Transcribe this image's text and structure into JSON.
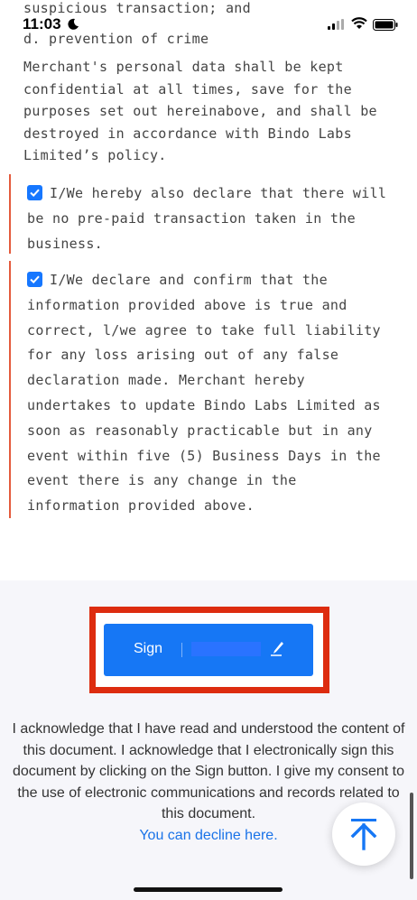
{
  "status_bar": {
    "time": "11:03",
    "overlap_text": "suspicious transaction; and"
  },
  "content": {
    "item_d": "d. prevention of crime",
    "confidentiality_paragraph": "Merchant's personal data shall be kept confidential at all times, save for the purposes set out hereinabove, and shall be destroyed in accordance with Bindo Labs Limited’s policy.",
    "declaration_1": {
      "checked": true,
      "text": "I/We hereby also declare that there will be no pre-paid transaction taken in the business."
    },
    "declaration_2": {
      "checked": true,
      "text": "I/We declare and confirm that the information provided above is true and correct, l/we agree to take full liability for any loss arising out of any false declaration made. Merchant hereby undertakes to update Bindo Labs Limited as soon as reasonably practicable but in any event within five (5) Business Days in the event there is any change in the information provided above."
    }
  },
  "sign": {
    "label": "Sign",
    "icon": "pen-icon"
  },
  "acknowledgement": {
    "text": "I acknowledge that I have read and understood the content of this document. I acknowledge that I electronically sign this document by clicking on the Sign button. I give my consent to the use of electronic communications and records related to this document.",
    "decline_link": "You can decline here."
  },
  "fab": {
    "icon": "arrow-up-to-top-icon"
  },
  "colors": {
    "accent": "#1677f5",
    "highlight": "#dd2c0f",
    "declaration_border": "#e45a3c",
    "link": "#1a73e8"
  }
}
